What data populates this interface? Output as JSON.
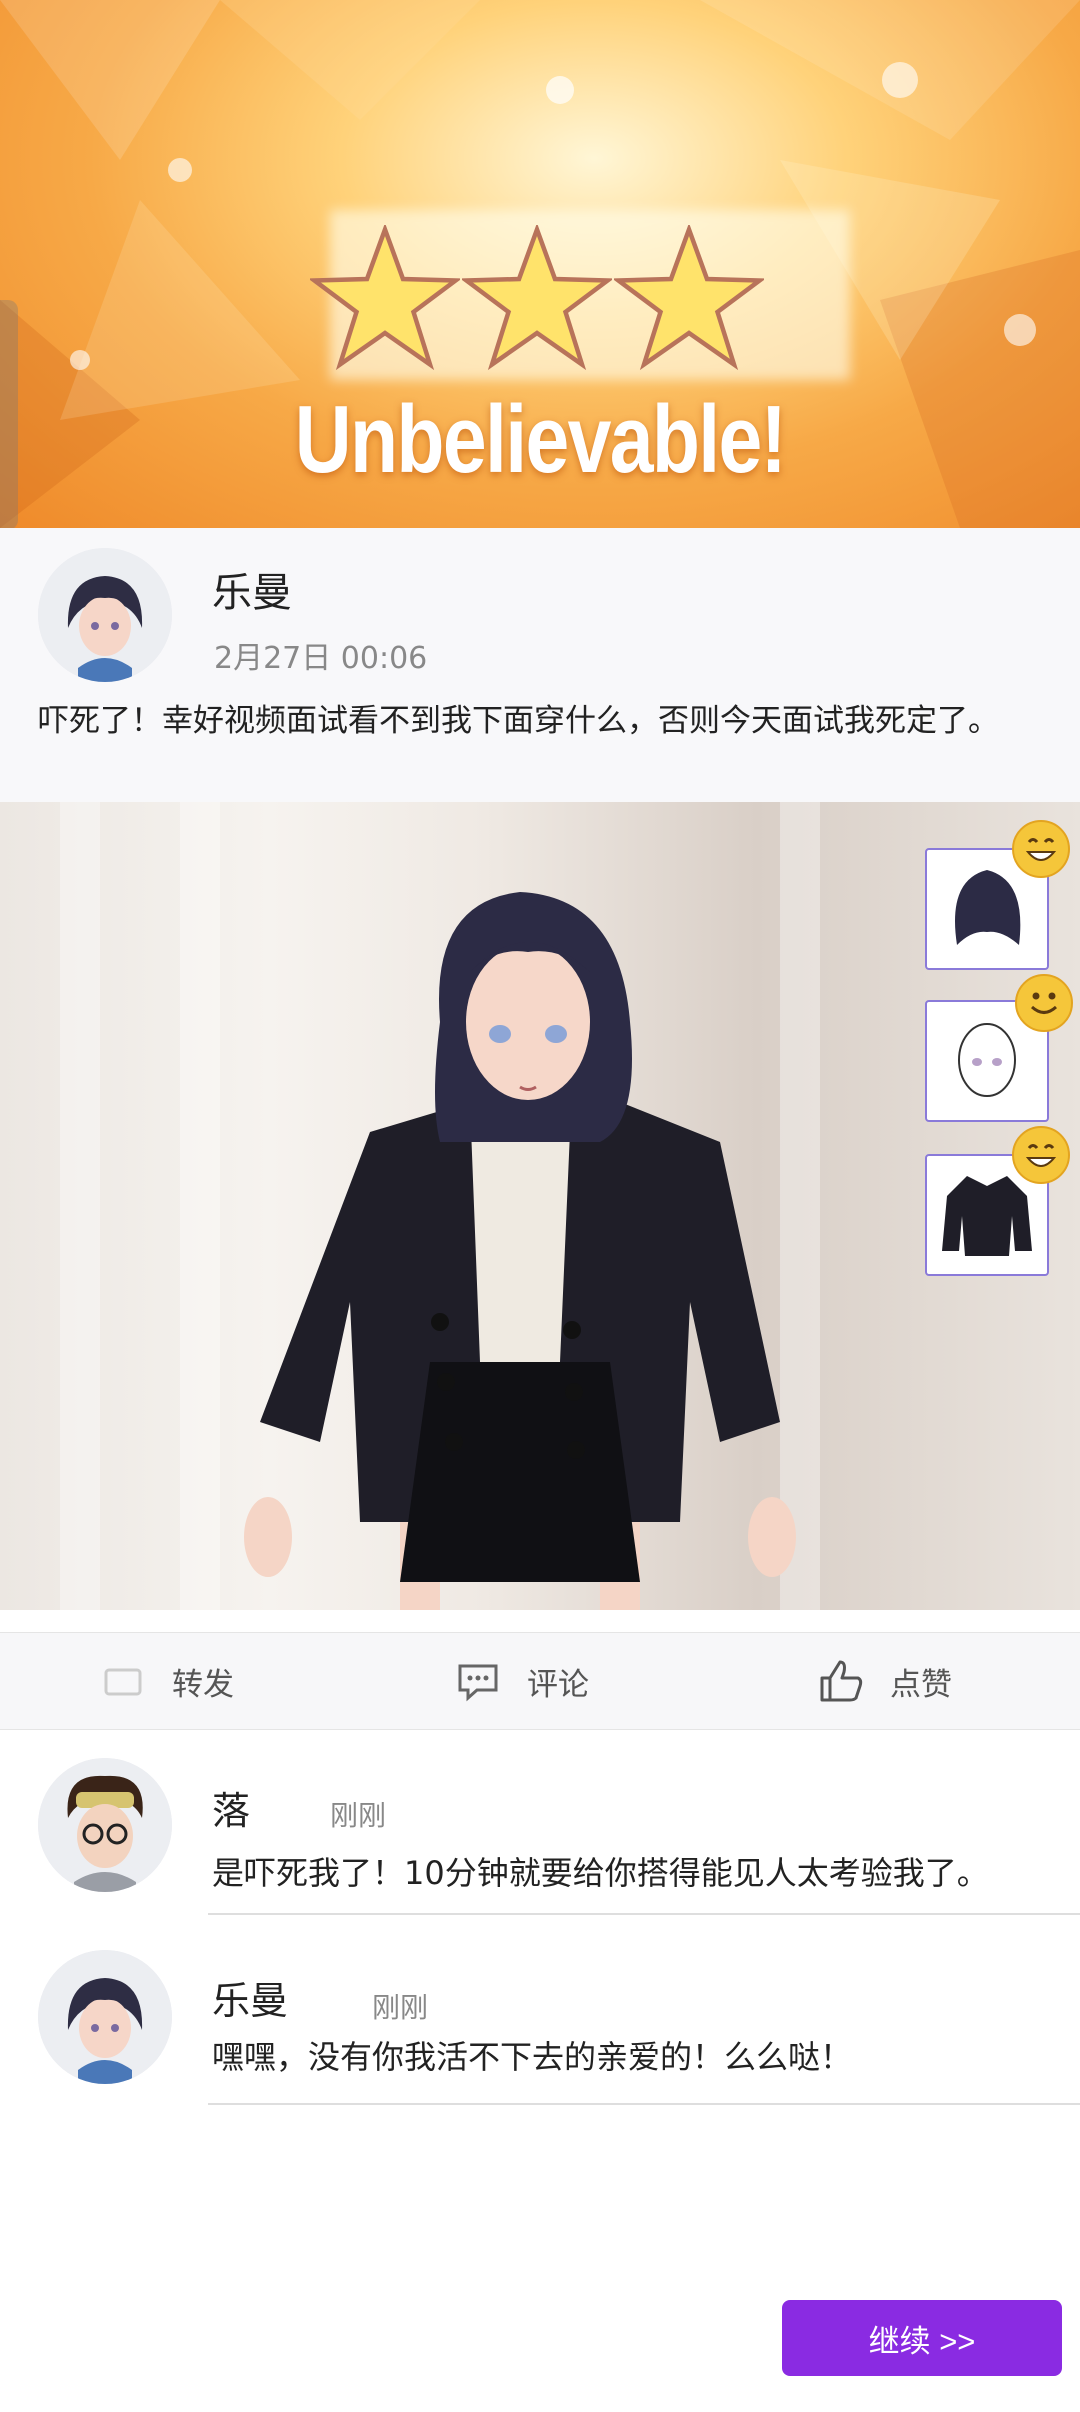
{
  "result": {
    "title": "Unbelievable!",
    "rating_stars": 3
  },
  "post": {
    "author": "乐曼",
    "time": "2月27日 00:06",
    "text": "吓死了！幸好视频面试看不到我下面穿什么，否则今天面试我死定了。"
  },
  "actions": {
    "share": "转发",
    "comment": "评论",
    "like": "点赞"
  },
  "comments": [
    {
      "name": "落",
      "time": "刚刚",
      "text": "是吓死我了！10分钟就要给你搭得能见人太考验我了。"
    },
    {
      "name": "乐曼",
      "time": "刚刚",
      "text": "嘿嘿，没有你我活不下去的亲爱的！么么哒！"
    }
  ],
  "outfit_items": [
    {
      "icon": "hair-icon",
      "reaction": "grin-emoji"
    },
    {
      "icon": "face-icon",
      "reaction": "smile-emoji"
    },
    {
      "icon": "jacket-icon",
      "reaction": "grin-emoji"
    }
  ],
  "continue_label": "继续 >>",
  "colors": {
    "accent": "#8a2be2",
    "banner": "#f7a947",
    "item_border": "#8a7ad9"
  }
}
